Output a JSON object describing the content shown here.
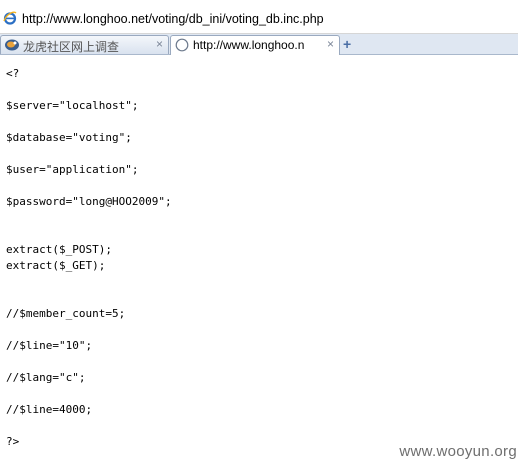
{
  "address_bar": {
    "url": "http://www.longhoo.net/voting/db_ini/voting_db.inc.php",
    "icon": "ie-page-icon"
  },
  "tabs": [
    {
      "label": "龙虎社区网上调查",
      "icon": "site-favicon",
      "close": "×",
      "active": false
    },
    {
      "label": "http://www.longhoo.n",
      "icon": "blank-page-icon",
      "close": "×",
      "active": true
    }
  ],
  "new_tab_label": "+",
  "source_lines": [
    "<?",
    "",
    "$server=\"localhost\";",
    "",
    "$database=\"voting\";",
    "",
    "$user=\"application\";",
    "",
    "$password=\"long@HOO2009\";",
    "",
    "",
    "extract($_POST);",
    "extract($_GET);",
    "",
    "",
    "//$member_count=5;",
    "",
    "//$line=\"10\";",
    "",
    "//$lang=\"c\";",
    "",
    "//$line=4000;",
    "",
    "?>"
  ],
  "watermark": "www.wooyun.org"
}
